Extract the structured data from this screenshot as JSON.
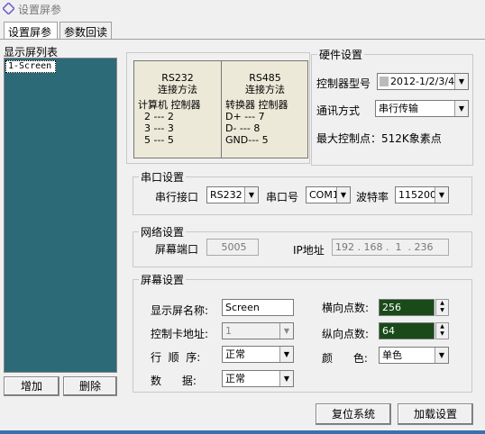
{
  "window": {
    "title": "设置屏参"
  },
  "tabs": [
    "设置屏参",
    "参数回读"
  ],
  "screen_list": {
    "label": "显示屏列表",
    "items": [
      "1-Screen"
    ],
    "add": "增加",
    "delete": "删除"
  },
  "diagram": {
    "rs232_title": "RS232\n连接方法",
    "rs232_body": "计算机 控制器\n  2 --- 2\n  3 --- 3\n  5 --- 5",
    "rs485_title": "RS485\n连接方法",
    "rs485_body": "转换器 控制器\nD+ --- 7\nD- --- 8\nGND--- 5"
  },
  "hardware": {
    "legend": "硬件设置",
    "model_label": "控制器型号",
    "model_value": "2012-1/2/3/4",
    "comm_label": "通讯方式",
    "comm_value": "串行传输",
    "max_points": "最大控制点：512K象素点"
  },
  "serial": {
    "legend": "串口设置",
    "port_label": "串行接口",
    "port_value": "RS232",
    "com_label": "串口号",
    "com_value": "COM1",
    "baud_label": "波特率",
    "baud_value": "115200"
  },
  "network": {
    "legend": "网络设置",
    "port_label": "屏幕端口",
    "port_value": "5005",
    "ip_label": "IP地址",
    "ip_value": "192 . 168 .  1  . 236"
  },
  "screen": {
    "legend": "屏幕设置",
    "name_label": "显示屏名称:",
    "name_value": "Screen",
    "addr_label": "控制卡地址:",
    "addr_value": "1",
    "order_label": "行  顺  序:",
    "order_value": "正常",
    "data_label": "数      据:",
    "data_value": "正常",
    "hpoints_label": "横向点数:",
    "hpoints_value": "256",
    "vpoints_label": "纵向点数:",
    "vpoints_value": "64",
    "color_label": "颜      色:",
    "color_value": "单色"
  },
  "buttons": {
    "reset": "复位系统",
    "load": "加载设置"
  }
}
